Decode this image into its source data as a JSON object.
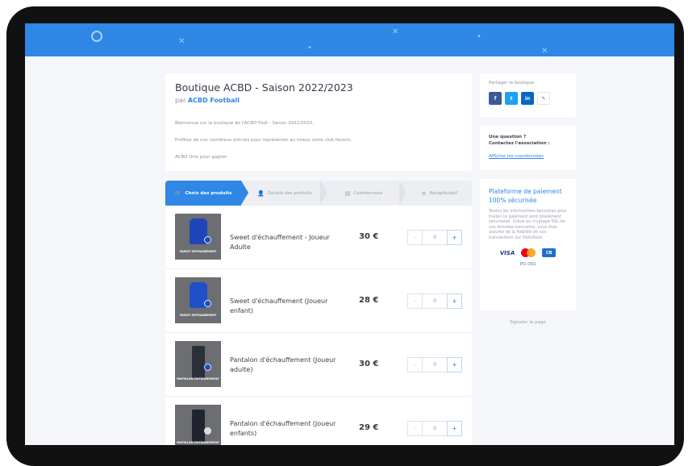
{
  "shop": {
    "title": "Boutique ACBD - Saison 2022/2023",
    "by_prefix": "par",
    "by_name": "ACBD Football",
    "desc1": "Bienvenue sur la boutique de l'ACBD Foot - Saison 2022/2023.",
    "desc2": "Profitez de nos nombreux articles pour représenter au mieux votre club favoris.",
    "desc3": "ACBD Unis pour gagner"
  },
  "tabs": [
    {
      "label": "Choix des produits",
      "icon": "cart-icon"
    },
    {
      "label": "Détails des produits",
      "icon": "user-icon"
    },
    {
      "label": "Coordonnées",
      "icon": "id-card-icon"
    },
    {
      "label": "Récapitulatif",
      "icon": "list-icon"
    }
  ],
  "products": [
    {
      "name": "Sweet d'échauffement - Joueur Adulte",
      "price": "30 €",
      "qty": "0",
      "thumb_label": "SWEAT ENTRAINEMENT"
    },
    {
      "name": "Sweet d'échauffement (Joueur enfant)",
      "price": "28 €",
      "qty": "0",
      "thumb_label": "SWEAT ENTRAINEMENT"
    },
    {
      "name": "Pantalon d'échauffement (Joueur adulte)",
      "price": "30 €",
      "qty": "0",
      "thumb_label": "PANTALON ENTRAINEMENT"
    },
    {
      "name": "Pantalon d'échauffement (Joueur enfants)",
      "price": "29 €",
      "qty": "0",
      "thumb_label": "PANTALON ENTRAINEMENT"
    }
  ],
  "stepper": {
    "minus": "-",
    "plus": "+"
  },
  "share": {
    "label": "Partager la boutique",
    "buttons": [
      {
        "glyph": "f",
        "icon": "facebook-icon",
        "color": "#3b5998"
      },
      {
        "glyph": "t",
        "icon": "twitter-icon",
        "color": "#1da1f2"
      },
      {
        "glyph": "in",
        "icon": "linkedin-icon",
        "color": "#0a66c2"
      },
      {
        "glyph": "✎",
        "icon": "link-icon",
        "color": "#ffffff"
      }
    ]
  },
  "contact": {
    "question": "Une question ?",
    "contact_label": "Contactez l'association :",
    "link": "Afficher les coordonnées"
  },
  "payment": {
    "title": "Plateforme de paiement 100% sécurisée",
    "text": "Toutes les informations bancaires pour traiter ce paiement sont totalement sécurisées. Grâce au cryptage SSL de vos données bancaires, vous êtes assurés de la fiabilité de vos transactions sur HelloAsso.",
    "visa": "VISA",
    "cb": "CB",
    "small": "PCI DSS"
  },
  "report": "Signaler la page",
  "colors": {
    "accent": "#2f87e6",
    "banner": "#2f87e6"
  }
}
